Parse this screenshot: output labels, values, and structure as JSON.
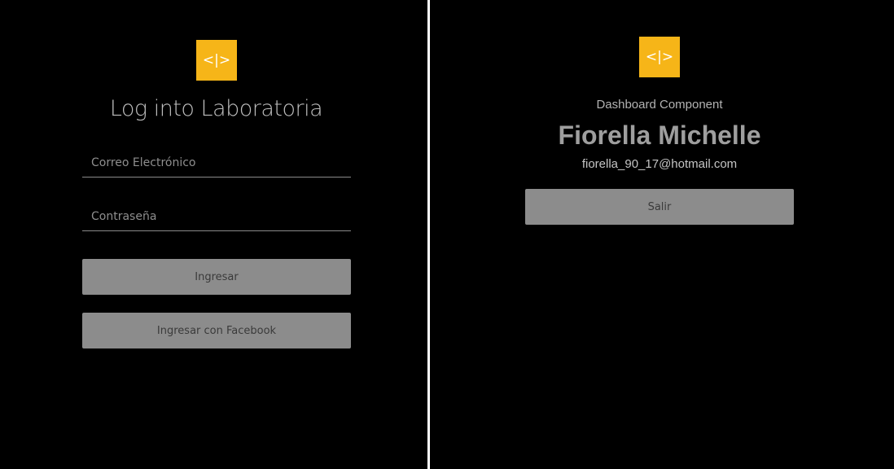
{
  "login": {
    "logo_text": "<|>",
    "title": "Log into Laboratoria",
    "email_placeholder": "Correo Electrónico",
    "password_placeholder": "Contraseña",
    "login_button": "Ingresar",
    "facebook_button": "Ingresar con Facebook"
  },
  "dashboard": {
    "logo_text": "<|>",
    "subtitle": "Dashboard Component",
    "user_name": "Fiorella Michelle",
    "user_email": "fiorella_90_17@hotmail.com",
    "logout_button": "Salir"
  },
  "colors": {
    "background": "#000000",
    "logo": "#f6b518",
    "button": "#8c8c8c",
    "divider": "#ffffff"
  }
}
